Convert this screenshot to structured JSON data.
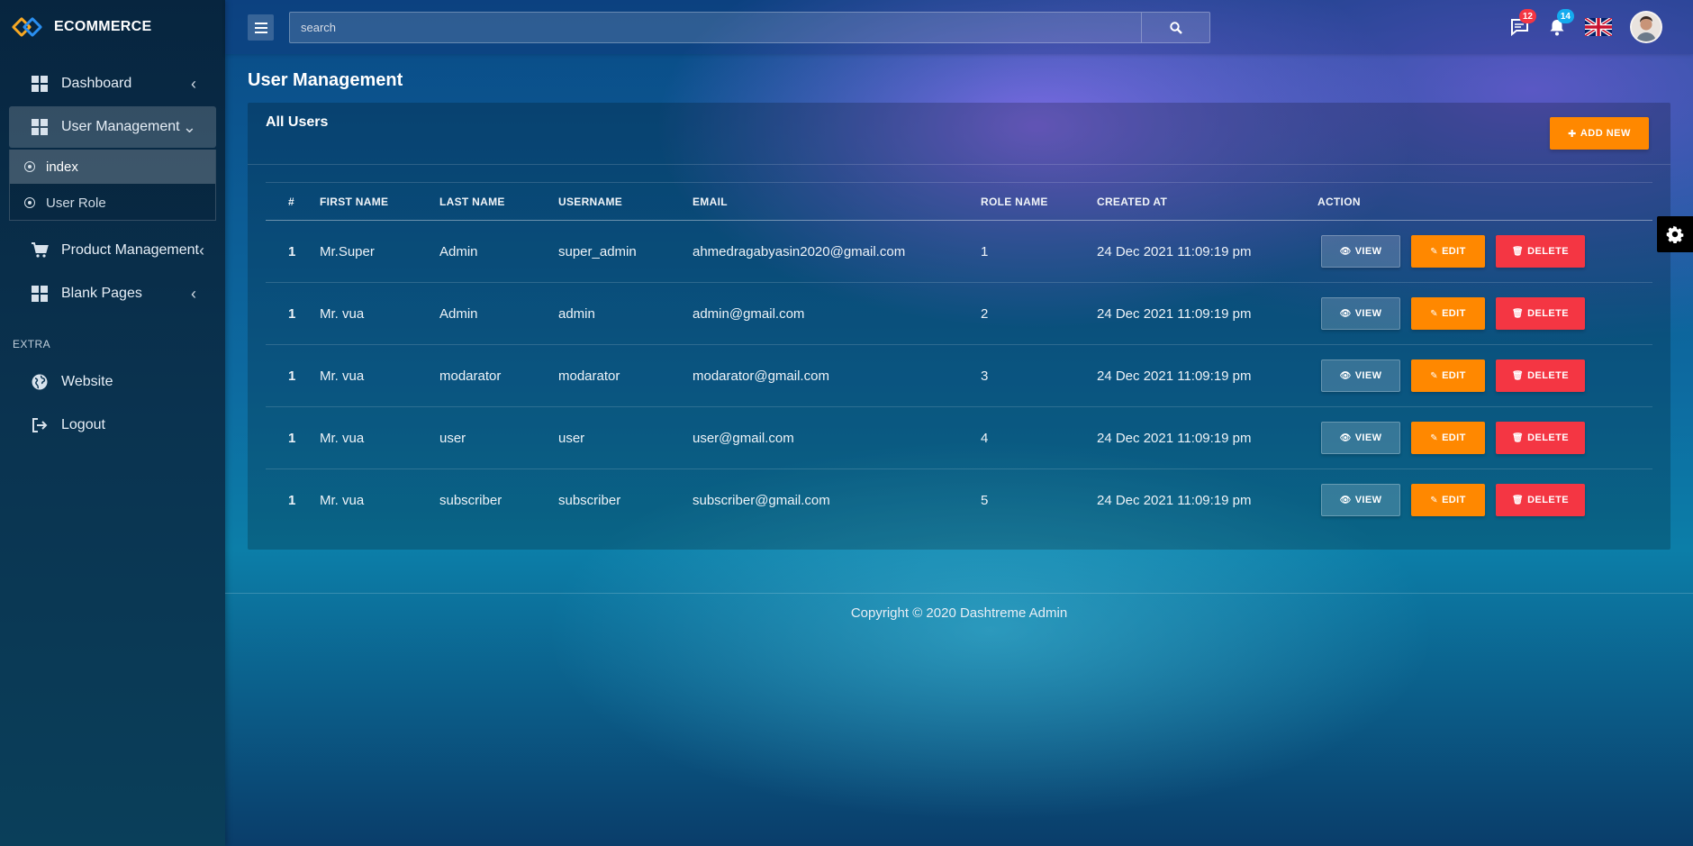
{
  "brand": {
    "name": "ECOMMERCE"
  },
  "sidebar": {
    "items": [
      {
        "label": "Dashboard"
      },
      {
        "label": "User Management",
        "submenu": [
          {
            "label": "index"
          },
          {
            "label": "User Role"
          }
        ]
      },
      {
        "label": "Product Management"
      },
      {
        "label": "Blank Pages"
      }
    ],
    "extra_heading": "EXTRA",
    "extra_items": [
      {
        "label": "Website"
      },
      {
        "label": "Logout"
      }
    ]
  },
  "topbar": {
    "search_placeholder": "search",
    "messages_count": "12",
    "notifications_count": "14"
  },
  "page": {
    "title": "User Management"
  },
  "card": {
    "title": "All Users",
    "add_label": "ADD NEW"
  },
  "table": {
    "headers": [
      "#",
      "FIRST NAME",
      "LAST NAME",
      "USERNAME",
      "EMAIL",
      "ROLE NAME",
      "CREATED AT",
      "ACTION"
    ],
    "rows": [
      {
        "id": "1",
        "first": "Mr.Super",
        "last": "Admin",
        "username": "super_admin",
        "email": "ahmedragabyasin2020@gmail.com",
        "role": "1",
        "created": "24 Dec 2021 11:09:19 pm"
      },
      {
        "id": "1",
        "first": "Mr. vua",
        "last": "Admin",
        "username": "admin",
        "email": "admin@gmail.com",
        "role": "2",
        "created": "24 Dec 2021 11:09:19 pm"
      },
      {
        "id": "1",
        "first": "Mr. vua",
        "last": "modarator",
        "username": "modarator",
        "email": "modarator@gmail.com",
        "role": "3",
        "created": "24 Dec 2021 11:09:19 pm"
      },
      {
        "id": "1",
        "first": "Mr. vua",
        "last": "user",
        "username": "user",
        "email": "user@gmail.com",
        "role": "4",
        "created": "24 Dec 2021 11:09:19 pm"
      },
      {
        "id": "1",
        "first": "Mr. vua",
        "last": "subscriber",
        "username": "subscriber",
        "email": "subscriber@gmail.com",
        "role": "5",
        "created": "24 Dec 2021 11:09:19 pm"
      }
    ],
    "actions": {
      "view": "VIEW",
      "edit": "EDIT",
      "delete": "DELETE"
    }
  },
  "footer": {
    "text": "Copyright © 2020 Dashtreme Admin"
  },
  "colors": {
    "accent_orange": "#ff8800",
    "danger_red": "#f43643",
    "info_blue": "#14abef"
  },
  "icons": {
    "brand": "diamond-logo-icon",
    "dashboard": "grid-icon",
    "product": "cart-icon",
    "website": "globe-icon",
    "logout": "sign-out-icon",
    "messages": "chat-icon",
    "notifications": "bell-icon",
    "settings": "gear-icon"
  }
}
